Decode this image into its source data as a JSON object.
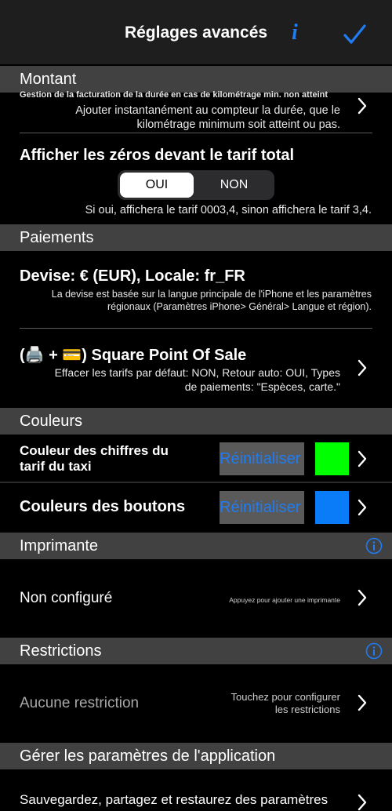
{
  "nav": {
    "title": "Réglages avancés",
    "info_glyph": "i"
  },
  "sections": {
    "montant": "Montant",
    "paiements": "Paiements",
    "couleurs": "Couleurs",
    "imprimante": "Imprimante",
    "restrictions": "Restrictions",
    "gerer": "Gérer les paramètres de l'application"
  },
  "montant": {
    "billing_title": "Gestion de la facturation de la durée  en cas de kilométrage min. non atteint",
    "billing_desc1": "Ajouter instantanément au compteur la durée, que le",
    "billing_desc2": "kilométrage minimum soit atteint ou pas.",
    "zeros_title": "Afficher les zéros devant le tarif total",
    "seg_oui": "OUI",
    "seg_non": "NON",
    "zeros_desc": "Si oui, affichera le tarif 0003,4, sinon affichera le tarif 3,4."
  },
  "paiements": {
    "devise_title": "Devise: € (EUR), Locale: fr_FR",
    "devise_desc1": "La devise est basée sur la langue principale de l'iPhone et les paramètres",
    "devise_desc2": "régionaux (Paramètres iPhone> Général> Langue et région).",
    "square_title": "(🖨️ + 💳) Square Point Of Sale",
    "square_desc1": "Effacer les tarifs par défaut: NON, Retour auto: OUI, Types",
    "square_desc2": "de paiements: \"Espèces, carte.\""
  },
  "couleurs": {
    "chiffres_line1": "Couleur des chiffres du",
    "chiffres_line2": "tarif du taxi",
    "reset_label": "Réinitialiser",
    "chiffres_color": "#00ff00",
    "boutons_label": "Couleurs des boutons",
    "boutons_color": "#0a7cf8"
  },
  "imprimante": {
    "status": "Non configuré",
    "hint": "Appuyez pour ajouter une imprimante"
  },
  "restrictions": {
    "status": "Aucune restriction",
    "hint1": "Touchez pour configurer",
    "hint2": "les restrictions"
  },
  "gerer": {
    "item": "Sauvegardez, partagez et restaurez des paramètres"
  },
  "colors": {
    "accent": "#1f7cf2",
    "section_bg": "#414141"
  }
}
